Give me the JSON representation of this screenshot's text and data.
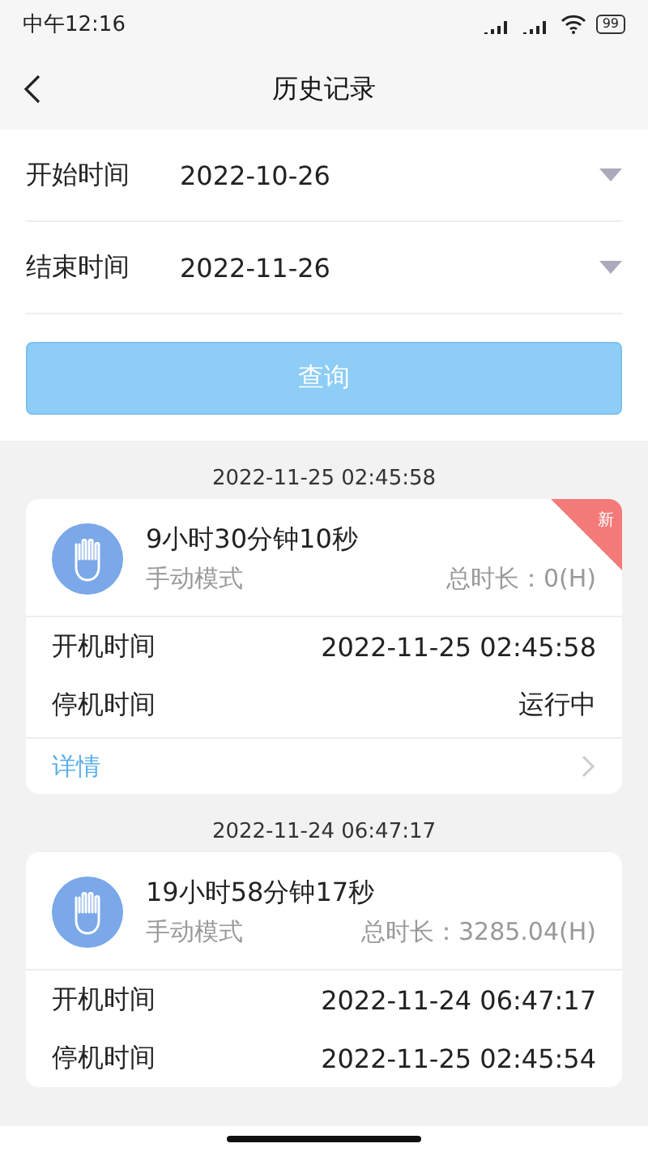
{
  "status_bar": {
    "time": "中午12:16",
    "battery": "99"
  },
  "header": {
    "title": "历史记录"
  },
  "filters": [
    {
      "label": "开始时间",
      "value": "2022-10-26"
    },
    {
      "label": "结束时间",
      "value": "2022-11-26"
    }
  ],
  "query_button": "查询",
  "records": [
    {
      "date": "2022-11-25 02:45:58",
      "duration": "9小时30分钟10秒",
      "mode": "手动模式",
      "total": "总时长：0(H)",
      "badge": "新",
      "start_label": "开机时间",
      "start_value": "2022-11-25 02:45:58",
      "stop_label": "停机时间",
      "stop_value": "运行中",
      "detail": "详情"
    },
    {
      "date": "2022-11-24 06:47:17",
      "duration": "19小时58分钟17秒",
      "mode": "手动模式",
      "total": "总时长：3285.04(H)",
      "start_label": "开机时间",
      "start_value": "2022-11-24 06:47:17",
      "stop_label": "停机时间",
      "stop_value": "2022-11-25 02:45:54"
    }
  ]
}
